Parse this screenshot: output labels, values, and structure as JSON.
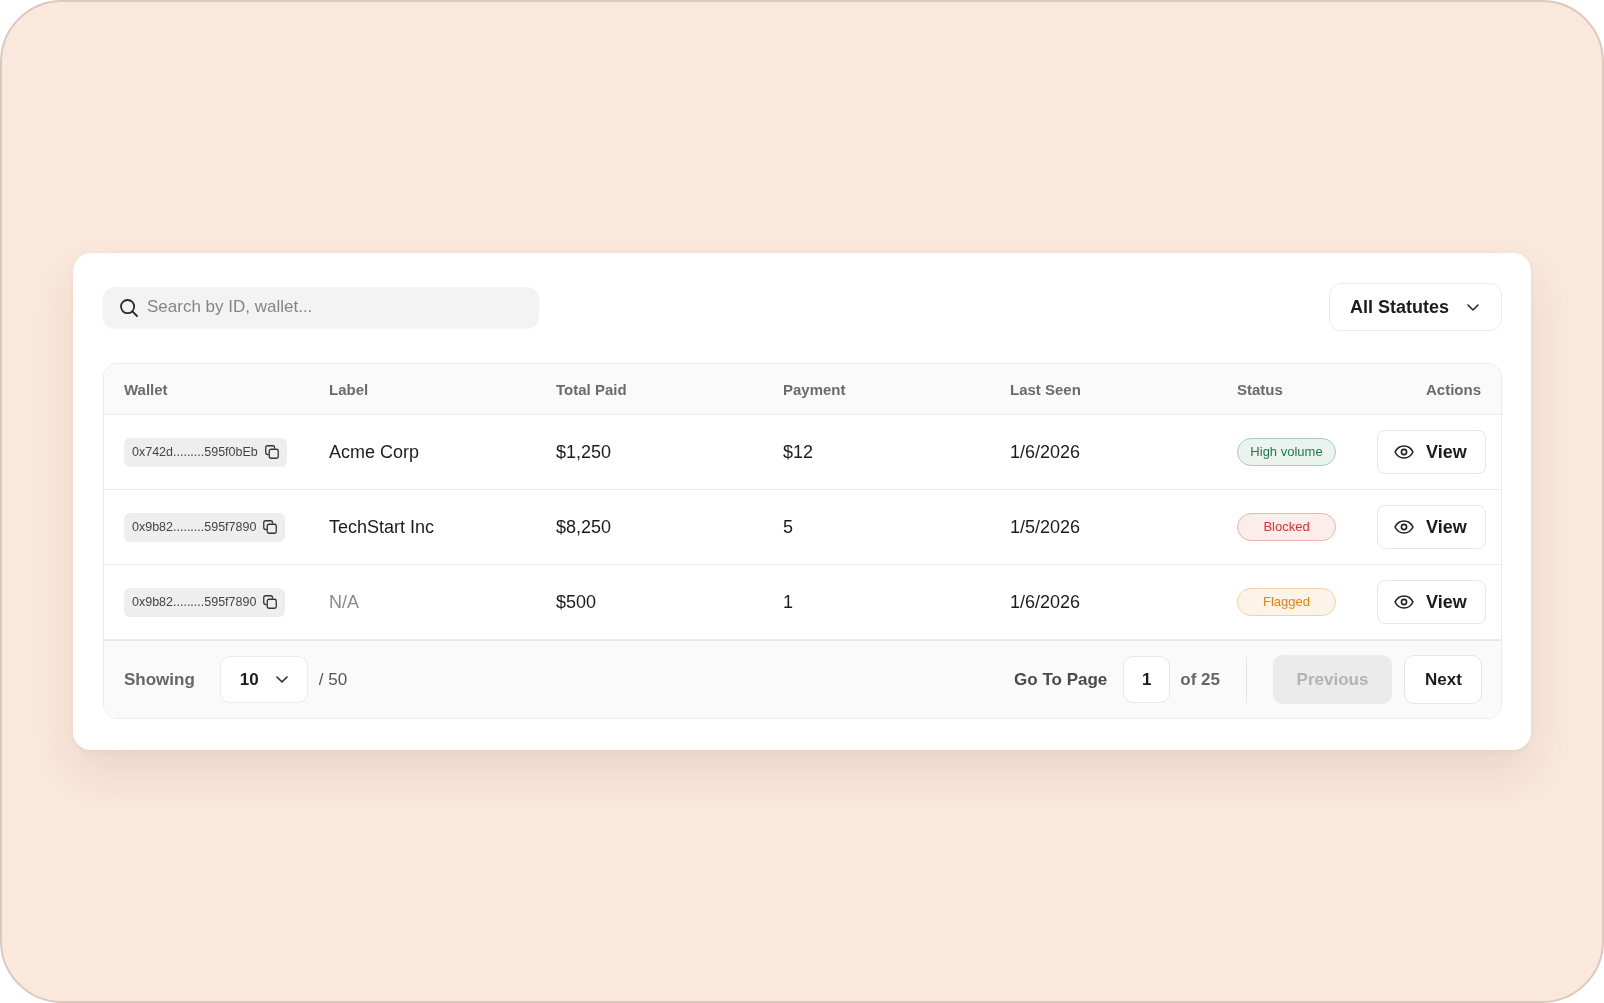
{
  "search": {
    "placeholder": "Search by ID, wallet..."
  },
  "status_filter": {
    "value": "All Statutes"
  },
  "table": {
    "columns": [
      "Wallet",
      "Label",
      "Total Paid",
      "Payment",
      "Last Seen",
      "Status",
      "Actions"
    ],
    "rows": [
      {
        "wallet": "0x742d.........595f0bEb",
        "label": "Acme Corp",
        "label_missing": false,
        "total_paid": "$1,250",
        "payment": "$12",
        "last_seen": "1/6/2026",
        "status": {
          "text": "High volume",
          "color": "#1f7a4c"
        },
        "action": "View"
      },
      {
        "wallet": "0x9b82.........595f7890",
        "label": "TechStart Inc",
        "label_missing": false,
        "total_paid": "$8,250",
        "payment": "5",
        "last_seen": "1/5/2026",
        "status": {
          "text": "Blocked",
          "color": "#d5352f"
        },
        "action": "View"
      },
      {
        "wallet": "0x9b82.........595f7890",
        "label": "N/A",
        "label_missing": true,
        "total_paid": "$500",
        "payment": "1",
        "last_seen": "1/6/2026",
        "status": {
          "text": "Flagged",
          "color": "#e8850f"
        },
        "action": "View"
      }
    ]
  },
  "pagination": {
    "showing_label": "Showing",
    "page_size": "10",
    "total": "/ 50",
    "go_to_label": "Go To Page",
    "page": "1",
    "page_count": "of 25",
    "previous": {
      "label": "Previous",
      "disabled": true
    },
    "next": {
      "label": "Next",
      "disabled": false
    }
  }
}
